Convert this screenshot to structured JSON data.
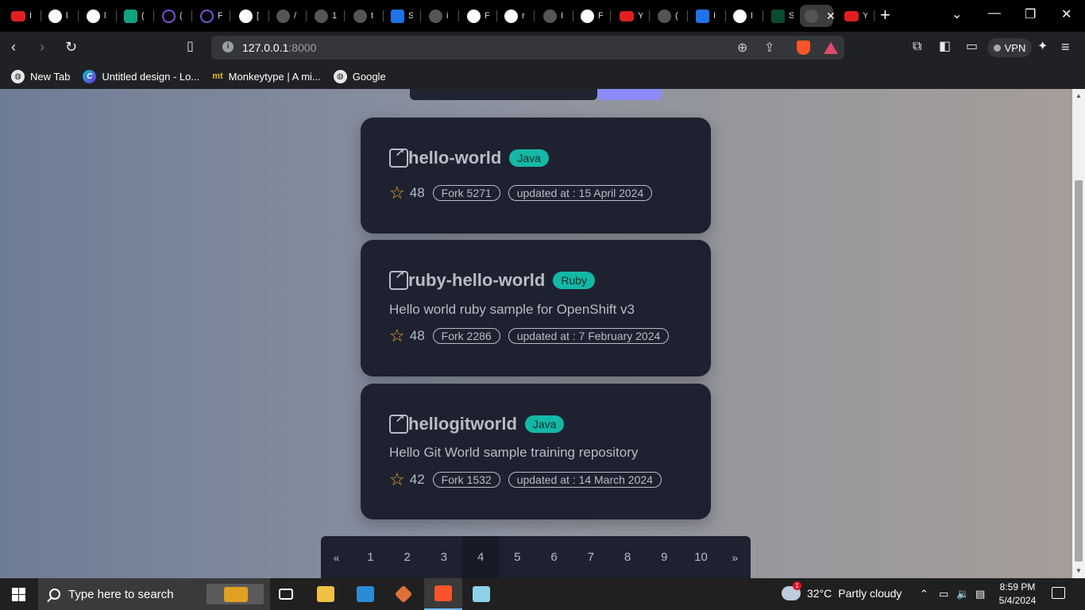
{
  "browser": {
    "tabs": [
      {
        "icon": "youtube-icon",
        "title": "I"
      },
      {
        "icon": "github-icon",
        "title": "l"
      },
      {
        "icon": "github-icon",
        "title": "l"
      },
      {
        "icon": "chatgpt-icon",
        "title": "("
      },
      {
        "icon": "microsoft-icon",
        "title": "("
      },
      {
        "icon": "microsoft-icon",
        "title": "F"
      },
      {
        "icon": "github-icon",
        "title": "["
      },
      {
        "icon": "pen-icon",
        "title": "/"
      },
      {
        "icon": "person-icon",
        "title": "1"
      },
      {
        "icon": "globe-icon",
        "title": "t"
      },
      {
        "icon": "docs-icon",
        "title": "S"
      },
      {
        "icon": "gear-icon",
        "title": "i"
      },
      {
        "icon": "github-icon",
        "title": "F"
      },
      {
        "icon": "github-icon",
        "title": "r"
      },
      {
        "icon": "cloud-icon",
        "title": "I"
      },
      {
        "icon": "github-icon",
        "title": "F"
      },
      {
        "icon": "youtube-music-icon",
        "title": "Y"
      },
      {
        "icon": "vite-icon",
        "title": "("
      },
      {
        "icon": "flag-icon",
        "title": "I"
      },
      {
        "icon": "github-icon",
        "title": "I"
      },
      {
        "icon": "django-icon",
        "title": "S"
      },
      {
        "icon": "blank-icon",
        "title": "("
      },
      {
        "icon": "youtube-icon",
        "title": "Y"
      }
    ],
    "new_tab_symbol": "+",
    "address": {
      "host": "127.0.0.1",
      "port": ":8000"
    },
    "vpn_label": "VPN",
    "bookmarks": [
      {
        "label": "New Tab",
        "icon": "globe-icon"
      },
      {
        "label": "Untitled design - Lo...",
        "icon": "canva-icon"
      },
      {
        "label": "Monkeytype | A mi...",
        "icon": "monkeytype-icon"
      },
      {
        "label": "Google",
        "icon": "globe-icon"
      }
    ],
    "bookmark_icon_glyphs": {
      "canva": "C",
      "monkeytype": "mt"
    }
  },
  "repos": [
    {
      "name": "hello-world",
      "language": "Java",
      "description": "",
      "stars": "48",
      "fork": "Fork 5271",
      "updated": "updated at : 15 April 2024"
    },
    {
      "name": "ruby-hello-world",
      "language": "Ruby",
      "description": "Hello world ruby sample for OpenShift v3",
      "stars": "48",
      "fork": "Fork 2286",
      "updated": "updated at : 7 February 2024"
    },
    {
      "name": "hellogitworld",
      "language": "Java",
      "description": "Hello Git World sample training repository",
      "stars": "42",
      "fork": "Fork 1532",
      "updated": "updated at : 14 March 2024"
    }
  ],
  "pagination": {
    "prev": "«",
    "next": "»",
    "pages": [
      "1",
      "2",
      "3",
      "4",
      "5",
      "6",
      "7",
      "8",
      "9",
      "10"
    ],
    "current": "4"
  },
  "taskbar": {
    "search_placeholder": "Type here to search",
    "weather": {
      "temp": "32°C",
      "condition": "Partly cloudy",
      "badge": "1"
    },
    "time": "8:59 PM",
    "date": "5/4/2024",
    "apps": [
      "task-view-icon",
      "file-explorer-icon",
      "vscode-icon",
      "git-icon",
      "brave-icon",
      "notepad-icon"
    ]
  },
  "colors": {
    "card_bg": "#1e2230",
    "language_badge": "#14b8a6",
    "star": "#f5a623",
    "text_muted": "#b8bcc6"
  }
}
